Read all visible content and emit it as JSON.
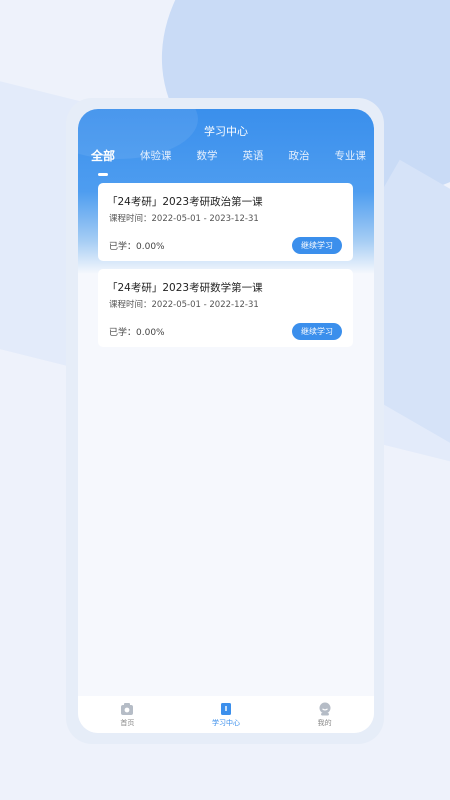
{
  "app": {
    "title": "学习中心"
  },
  "tabs": [
    {
      "label": "全部",
      "active": true
    },
    {
      "label": "体验课"
    },
    {
      "label": "数学"
    },
    {
      "label": "英语"
    },
    {
      "label": "政治"
    },
    {
      "label": "专业课"
    }
  ],
  "courses": [
    {
      "title": "「24考研」2023考研政治第一课",
      "time_label": "课程时间：",
      "time_value": "2022-05-01 - 2023-12-31",
      "progress_label": "已学：",
      "progress_value": "0.00%",
      "button": "继续学习"
    },
    {
      "title": "「24考研」2023考研数学第一课",
      "time_label": "课程时间：",
      "time_value": "2022-05-01 - 2022-12-31",
      "progress_label": "已学：",
      "progress_value": "0.00%",
      "button": "继续学习"
    }
  ],
  "nav": [
    {
      "label": "首页",
      "icon": "home-icon"
    },
    {
      "label": "学习中心",
      "icon": "book-icon",
      "active": true
    },
    {
      "label": "我的",
      "icon": "profile-icon"
    }
  ],
  "colors": {
    "accent": "#3b8fec",
    "inactive": "#b5bcc6"
  }
}
